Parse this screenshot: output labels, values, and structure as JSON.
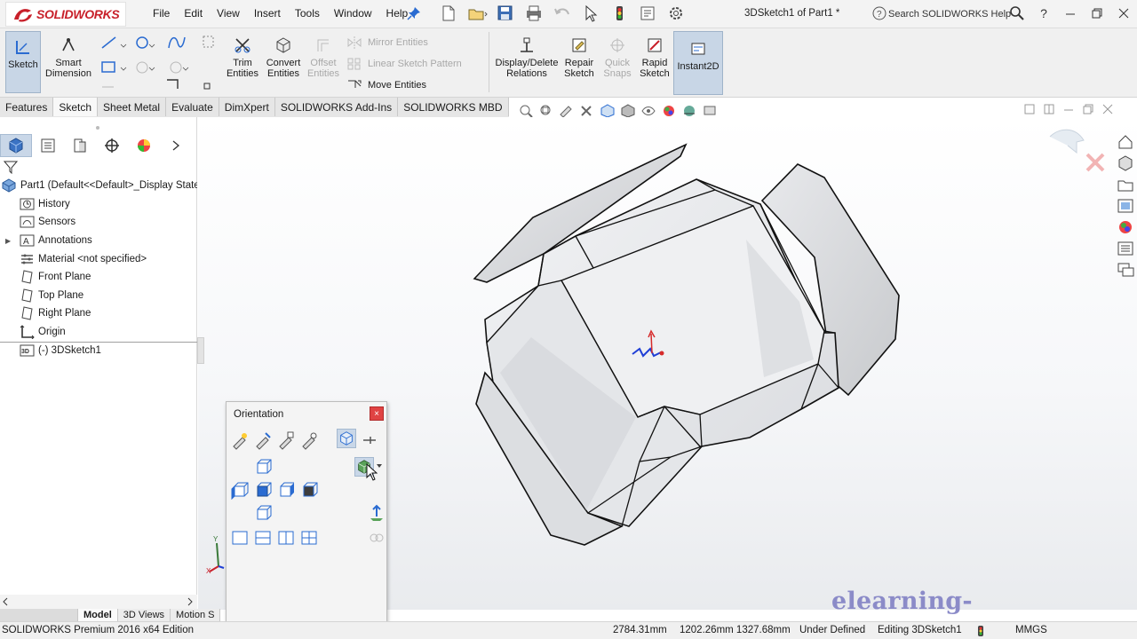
{
  "app": {
    "logo_text": "SOLIDWORKS",
    "document_title": "3DSketch1 of Part1 *",
    "search_placeholder": "Search SOLIDWORKS Help",
    "help_label": "?"
  },
  "menu": [
    "File",
    "Edit",
    "View",
    "Insert",
    "Tools",
    "Window",
    "Help"
  ],
  "ribbon": {
    "sketch": "Sketch",
    "smart_dimension": [
      "Smart",
      "Dimension"
    ],
    "trim_entities": [
      "Trim",
      "Entities"
    ],
    "convert_entities": [
      "Convert",
      "Entities"
    ],
    "offset_entities": [
      "Offset",
      "Entities"
    ],
    "mirror_entities": "Mirror Entities",
    "linear_sketch_pattern": "Linear Sketch Pattern",
    "move_entities": "Move Entities",
    "display_delete_relations": [
      "Display/Delete",
      "Relations"
    ],
    "repair_sketch": [
      "Repair",
      "Sketch"
    ],
    "quick_snaps": [
      "Quick",
      "Snaps"
    ],
    "rapid_sketch": [
      "Rapid",
      "Sketch"
    ],
    "instant2d": "Instant2D"
  },
  "tabs": [
    "Features",
    "Sketch",
    "Sheet Metal",
    "Evaluate",
    "DimXpert",
    "SOLIDWORKS Add-Ins",
    "SOLIDWORKS MBD"
  ],
  "tree": {
    "root": "Part1  (Default<<Default>_Display State",
    "items": [
      {
        "label": "History",
        "icon": "history-folder-icon"
      },
      {
        "label": "Sensors",
        "icon": "sensors-folder-icon"
      },
      {
        "label": "Annotations",
        "icon": "annotations-icon"
      },
      {
        "label": "Material <not specified>",
        "icon": "material-icon"
      },
      {
        "label": "Front Plane",
        "icon": "plane-icon"
      },
      {
        "label": "Top Plane",
        "icon": "plane-icon"
      },
      {
        "label": "Right Plane",
        "icon": "plane-icon"
      },
      {
        "label": "Origin",
        "icon": "origin-icon"
      },
      {
        "label": "(-) 3DSketch1",
        "icon": "3d-sketch-icon"
      }
    ]
  },
  "bottom_tabs": [
    "Model",
    "3D Views",
    "Motion S"
  ],
  "orientation": {
    "title": "Orientation",
    "close": "×"
  },
  "status": {
    "edition": "SOLIDWORKS Premium 2016 x64 Edition",
    "coord_1": "2784.31mm",
    "coord_2": "1202.26mm 1327.68mm",
    "state": "Under Defined",
    "editing": "Editing 3DSketch1",
    "units": "MMGS"
  },
  "watermark": "elearning-myanmar.com",
  "colors": {
    "accent": "#2a6bd1",
    "brand_red": "#c8202a",
    "active_button": "#c8d6e6"
  }
}
